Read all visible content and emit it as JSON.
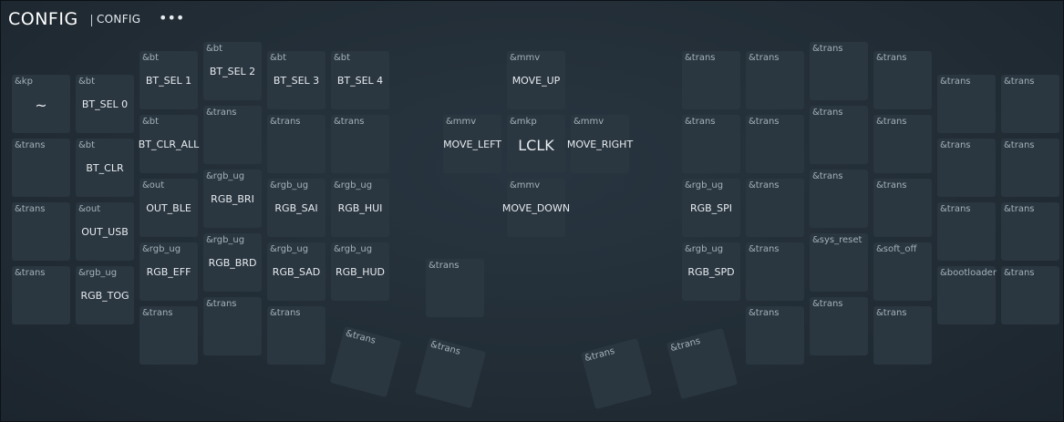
{
  "header": {
    "title": "CONFIG",
    "breadcrumb": "CONFIG",
    "more_icon": "more-horizontal-icon"
  },
  "keys": [
    {
      "b": "&kp",
      "p": "~"
    },
    {
      "b": "&bt",
      "p": "BT_SEL 0"
    },
    {
      "b": "&bt",
      "p": "BT_SEL 1"
    },
    {
      "b": "&bt",
      "p": "BT_SEL 2"
    },
    {
      "b": "&bt",
      "p": "BT_SEL 3"
    },
    {
      "b": "&bt",
      "p": "BT_SEL 4"
    },
    {
      "b": "&mmv",
      "p": "MOVE_UP"
    },
    {
      "b": "&trans",
      "p": ""
    },
    {
      "b": "&trans",
      "p": ""
    },
    {
      "b": "&trans",
      "p": ""
    },
    {
      "b": "&trans",
      "p": ""
    },
    {
      "b": "&trans",
      "p": ""
    },
    {
      "b": "&trans",
      "p": ""
    },
    {
      "b": "&trans",
      "p": ""
    },
    {
      "b": "&bt",
      "p": "BT_CLR"
    },
    {
      "b": "&bt",
      "p": "BT_CLR_ALL"
    },
    {
      "b": "&trans",
      "p": ""
    },
    {
      "b": "&trans",
      "p": ""
    },
    {
      "b": "&trans",
      "p": ""
    },
    {
      "b": "&mmv",
      "p": "MOVE_LEFT"
    },
    {
      "b": "&mkp",
      "p": "LCLK"
    },
    {
      "b": "&mmv",
      "p": "MOVE_RIGHT"
    },
    {
      "b": "&trans",
      "p": ""
    },
    {
      "b": "&trans",
      "p": ""
    },
    {
      "b": "&trans",
      "p": ""
    },
    {
      "b": "&trans",
      "p": ""
    },
    {
      "b": "&trans",
      "p": ""
    },
    {
      "b": "&trans",
      "p": ""
    },
    {
      "b": "&trans",
      "p": ""
    },
    {
      "b": "&out",
      "p": "OUT_USB"
    },
    {
      "b": "&out",
      "p": "OUT_BLE"
    },
    {
      "b": "&rgb_ug",
      "p": "RGB_BRI"
    },
    {
      "b": "&rgb_ug",
      "p": "RGB_SAI"
    },
    {
      "b": "&rgb_ug",
      "p": "RGB_HUI"
    },
    {
      "b": "&mmv",
      "p": "MOVE_DOWN"
    },
    {
      "b": "&rgb_ug",
      "p": "RGB_SPI"
    },
    {
      "b": "&trans",
      "p": ""
    },
    {
      "b": "&trans",
      "p": ""
    },
    {
      "b": "&trans",
      "p": ""
    },
    {
      "b": "&trans",
      "p": ""
    },
    {
      "b": "&trans",
      "p": ""
    },
    {
      "b": "&trans",
      "p": ""
    },
    {
      "b": "&rgb_ug",
      "p": "RGB_TOG"
    },
    {
      "b": "&rgb_ug",
      "p": "RGB_EFF"
    },
    {
      "b": "&rgb_ug",
      "p": "RGB_BRD"
    },
    {
      "b": "&rgb_ug",
      "p": "RGB_SAD"
    },
    {
      "b": "&rgb_ug",
      "p": "RGB_HUD"
    },
    {
      "b": "&trans",
      "p": ""
    },
    {
      "b": "&rgb_ug",
      "p": "RGB_SPD"
    },
    {
      "b": "&trans",
      "p": ""
    },
    {
      "b": "&sys_reset",
      "p": ""
    },
    {
      "b": "&soft_off",
      "p": ""
    },
    {
      "b": "&bootloader",
      "p": ""
    },
    {
      "b": "&trans",
      "p": ""
    },
    {
      "b": "&trans",
      "p": ""
    },
    {
      "b": "&trans",
      "p": ""
    },
    {
      "b": "&trans",
      "p": ""
    },
    {
      "b": "&trans",
      "p": ""
    },
    {
      "b": "&trans",
      "p": ""
    },
    {
      "b": "&trans",
      "p": ""
    },
    {
      "b": "&trans",
      "p": ""
    },
    {
      "b": "&trans",
      "p": ""
    },
    {
      "b": "&trans",
      "p": ""
    },
    {
      "b": "&trans",
      "p": ""
    }
  ]
}
